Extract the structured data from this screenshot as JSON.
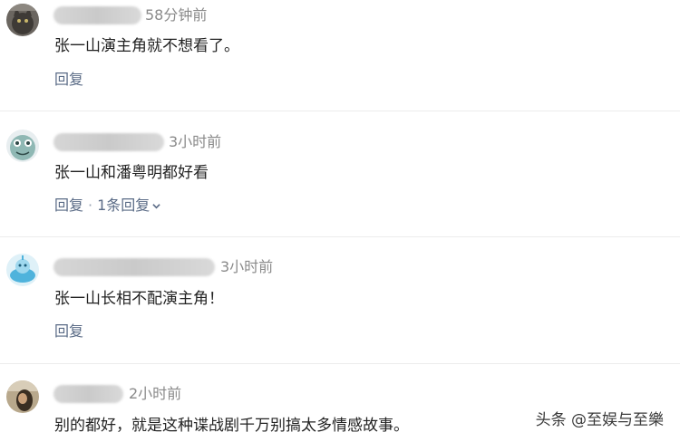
{
  "comments": [
    {
      "time": "58分钟前",
      "text": "张一山演主角就不想看了。",
      "reply": "回复"
    },
    {
      "time": "3小时前",
      "text": "张一山和潘粤明都好看",
      "reply": "回复",
      "sep": "·",
      "replies_link": "1条回复"
    },
    {
      "time": "3小时前",
      "text": "张一山长相不配演主角！",
      "reply": "回复"
    },
    {
      "time": "2小时前",
      "text": "别的都好，就是这种谍战剧千万别搞太多情感故事。"
    }
  ],
  "watermark": "头条 @至娱与至樂",
  "colors": {
    "action": "#5a6b86",
    "time": "#8a8a8a",
    "divider": "#ececec"
  }
}
